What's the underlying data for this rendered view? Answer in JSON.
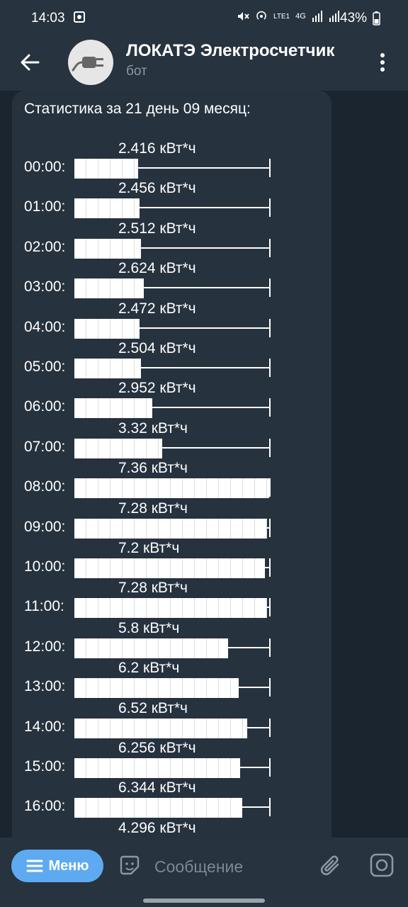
{
  "status_bar": {
    "time": "14:03",
    "network": "LTE1",
    "network_gen": "4G",
    "battery": "43%"
  },
  "header": {
    "title": "ЛОКАТЭ Электросчетчик",
    "subtitle": "бот"
  },
  "message": {
    "title": "Статистика за 21 день 09 месяц:",
    "rows": [
      {
        "time": "00:00:",
        "value": "2.416 кВт*ч",
        "kwh": 2.416
      },
      {
        "time": "01:00:",
        "value": "2.456 кВт*ч",
        "kwh": 2.456
      },
      {
        "time": "02:00:",
        "value": "2.512 кВт*ч",
        "kwh": 2.512
      },
      {
        "time": "03:00:",
        "value": "2.624 кВт*ч",
        "kwh": 2.624
      },
      {
        "time": "04:00:",
        "value": "2.472 кВт*ч",
        "kwh": 2.472
      },
      {
        "time": "05:00:",
        "value": "2.504 кВт*ч",
        "kwh": 2.504
      },
      {
        "time": "06:00:",
        "value": "2.952 кВт*ч",
        "kwh": 2.952
      },
      {
        "time": "07:00:",
        "value": "3.32 кВт*ч",
        "kwh": 3.32
      },
      {
        "time": "08:00:",
        "value": "7.36 кВт*ч",
        "kwh": 7.36
      },
      {
        "time": "09:00:",
        "value": "7.28 кВт*ч",
        "kwh": 7.28
      },
      {
        "time": "10:00:",
        "value": "7.2 кВт*ч",
        "kwh": 7.2
      },
      {
        "time": "11:00:",
        "value": "7.28 кВт*ч",
        "kwh": 7.28
      },
      {
        "time": "12:00:",
        "value": "5.8 кВт*ч",
        "kwh": 5.8
      },
      {
        "time": "13:00:",
        "value": "6.2 кВт*ч",
        "kwh": 6.2
      },
      {
        "time": "14:00:",
        "value": "6.52 кВт*ч",
        "kwh": 6.52
      },
      {
        "time": "15:00:",
        "value": "6.256 кВт*ч",
        "kwh": 6.256
      },
      {
        "time": "16:00:",
        "value": "6.344 кВт*ч",
        "kwh": 6.344
      },
      {
        "time": "",
        "value": "4.296 кВт*ч",
        "kwh": 4.296
      }
    ]
  },
  "input_bar": {
    "menu_label": "Меню",
    "placeholder": "Сообщение"
  },
  "colors": {
    "background": "#1b2530",
    "bar": "#27333f",
    "bubble": "#26323e",
    "accent": "#5eaaf1"
  },
  "icons": [
    "back-arrow-icon",
    "plug-icon",
    "more-vert-icon",
    "menu-lines-icon",
    "sticker-icon",
    "paperclip-icon",
    "camera-icon"
  ]
}
